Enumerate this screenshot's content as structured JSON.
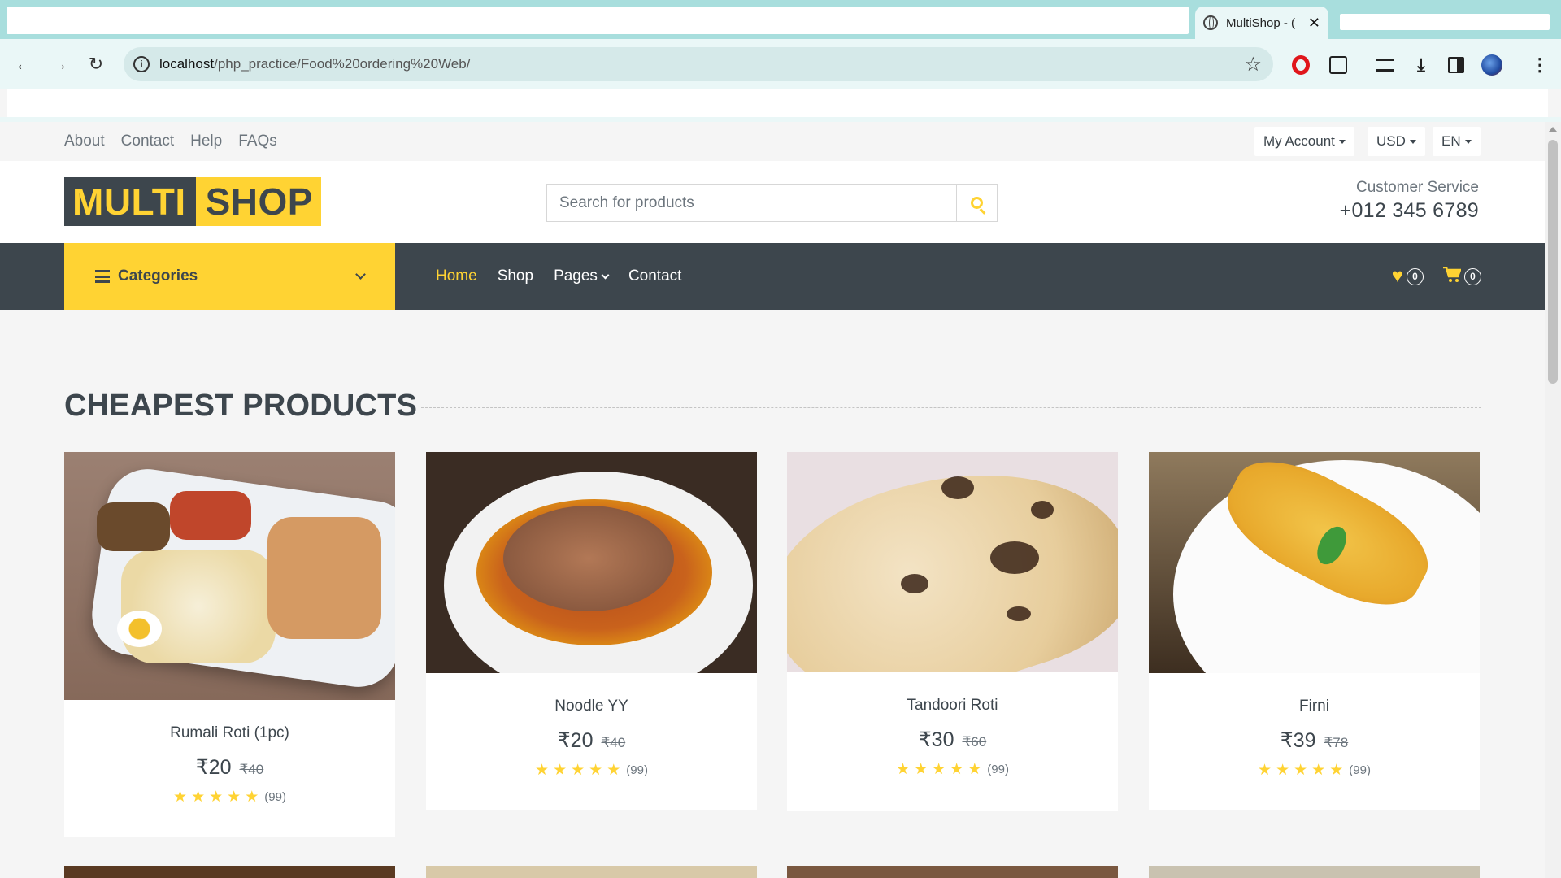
{
  "browser": {
    "tab_title": "MultiShop - (",
    "tab_close": "✕",
    "url_host": "localhost",
    "url_path": "/php_practice/Food%20ordering%20Web/",
    "back_glyph": "←",
    "forward_glyph": "→",
    "reload_glyph": "↻",
    "bookmark_glyph": "☆",
    "download_glyph": "⤓",
    "menu_glyph": "⋮",
    "info_glyph": "i"
  },
  "topbar": {
    "links": [
      "About",
      "Contact",
      "Help",
      "FAQs"
    ],
    "account_label": "My Account",
    "currency_label": "USD",
    "language_label": "EN"
  },
  "header": {
    "logo_part1": "MULTI",
    "logo_part2": "SHOP",
    "search_placeholder": "Search for products",
    "customer_service_label": "Customer Service",
    "customer_service_phone": "+012 345 6789"
  },
  "navbar": {
    "categories_label": "Categories",
    "items": [
      "Home",
      "Shop",
      "Pages",
      "Contact"
    ],
    "active_item": "Home",
    "wishlist_count": "0",
    "cart_count": "0"
  },
  "section": {
    "title": "CHEAPEST PRODUCTS"
  },
  "products": [
    {
      "name": "Rumali Roti (1pc)",
      "price": "₹20",
      "old_price": "₹40",
      "rating": 5,
      "reviews": "(99)"
    },
    {
      "name": "Noodle YY",
      "price": "₹20",
      "old_price": "₹40",
      "rating": 5,
      "reviews": "(99)"
    },
    {
      "name": "Tandoori Roti",
      "price": "₹30",
      "old_price": "₹60",
      "rating": 5,
      "reviews": "(99)"
    },
    {
      "name": "Firni",
      "price": "₹39",
      "old_price": "₹78",
      "rating": 5,
      "reviews": "(99)"
    }
  ],
  "colors": {
    "brand_yellow": "#ffd333",
    "brand_dark": "#3d464d",
    "page_bg": "#f5f5f5"
  },
  "icons": {
    "star": "★",
    "heart": "♥",
    "cart": "🛒"
  }
}
